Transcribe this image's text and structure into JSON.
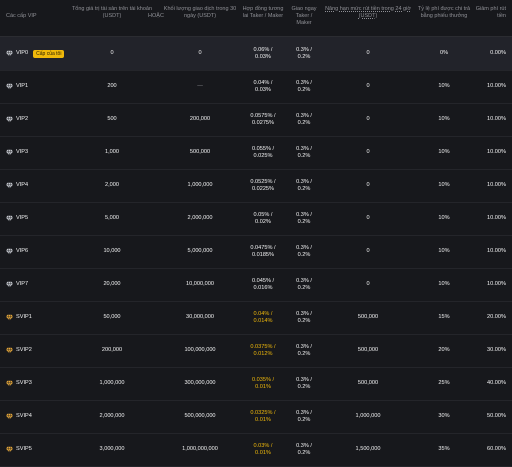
{
  "headers": {
    "level": "Các cấp VIP",
    "assets": "Tổng giá trị tài sản trên tài khoản (USDT)",
    "or": "HOẶC",
    "spot_vol": "Khối lượng giao dịch trong 30 ngày (USDT)",
    "futures": "Hợp đồng tương lai Taker / Maker",
    "spot_fee": "Giao ngay Taker / Maker",
    "withdraw_limit": "Nâng hạn mức rút tiền trong 24 giờ (USDT)",
    "bonus": "Tỷ lệ phí được chi trả bằng phiếu thưởng",
    "withdraw_fee": "Giảm phí rút tiền"
  },
  "current_badge": "Cấp của tôi",
  "rows": [
    {
      "level": "VIP0",
      "assets": "0",
      "volume": "0",
      "futures": "0.06% / 0.03%",
      "spot": "0.3% / 0.2%",
      "limit": "0",
      "bonus": "0%",
      "wfee": "0.00%"
    },
    {
      "level": "VIP1",
      "assets": "200",
      "volume": "—",
      "futures": "0.04% / 0.03%",
      "spot": "0.3% / 0.2%",
      "limit": "0",
      "bonus": "10%",
      "wfee": "10.00%"
    },
    {
      "level": "VIP2",
      "assets": "500",
      "volume": "200,000",
      "futures": "0.0575% / 0.0275%",
      "spot": "0.3% / 0.2%",
      "limit": "0",
      "bonus": "10%",
      "wfee": "10.00%"
    },
    {
      "level": "VIP3",
      "assets": "1,000",
      "volume": "500,000",
      "futures": "0.055% / 0.025%",
      "spot": "0.3% / 0.2%",
      "limit": "0",
      "bonus": "10%",
      "wfee": "10.00%"
    },
    {
      "level": "VIP4",
      "assets": "2,000",
      "volume": "1,000,000",
      "futures": "0.0525% / 0.0225%",
      "spot": "0.3% / 0.2%",
      "limit": "0",
      "bonus": "10%",
      "wfee": "10.00%"
    },
    {
      "level": "VIP5",
      "assets": "5,000",
      "volume": "2,000,000",
      "futures": "0.05% / 0.02%",
      "spot": "0.3% / 0.2%",
      "limit": "0",
      "bonus": "10%",
      "wfee": "10.00%"
    },
    {
      "level": "VIP6",
      "assets": "10,000",
      "volume": "5,000,000",
      "futures": "0.0475% / 0.0185%",
      "spot": "0.3% / 0.2%",
      "limit": "0",
      "bonus": "10%",
      "wfee": "10.00%"
    },
    {
      "level": "VIP7",
      "assets": "20,000",
      "volume": "10,000,000",
      "futures": "0.045% / 0.016%",
      "spot": "0.3% / 0.2%",
      "limit": "0",
      "bonus": "10%",
      "wfee": "10.00%"
    },
    {
      "level": "SVIP1",
      "assets": "50,000",
      "volume": "30,000,000",
      "futures": "0.04% / 0.014%",
      "spot": "0.3% / 0.2%",
      "limit": "500,000",
      "bonus": "15%",
      "wfee": "20.00%"
    },
    {
      "level": "SVIP2",
      "assets": "200,000",
      "volume": "100,000,000",
      "futures": "0.0375% / 0.012%",
      "spot": "0.3% / 0.2%",
      "limit": "500,000",
      "bonus": "20%",
      "wfee": "30.00%"
    },
    {
      "level": "SVIP3",
      "assets": "1,000,000",
      "volume": "300,000,000",
      "futures": "0.035% / 0.01%",
      "spot": "0.3% / 0.2%",
      "limit": "500,000",
      "bonus": "25%",
      "wfee": "40.00%"
    },
    {
      "level": "SVIP4",
      "assets": "2,000,000",
      "volume": "500,000,000",
      "futures": "0.0325% / 0.01%",
      "spot": "0.3% / 0.2%",
      "limit": "1,000,000",
      "bonus": "30%",
      "wfee": "50.00%"
    },
    {
      "level": "SVIP5",
      "assets": "3,000,000",
      "volume": "1,000,000,000",
      "futures": "0.03% / 0.01%",
      "spot": "0.3% / 0.2%",
      "limit": "1,500,000",
      "bonus": "35%",
      "wfee": "60.00%"
    }
  ],
  "colors": {
    "accent": "#f0b90b",
    "gem_silver": "#c9ccd3",
    "gem_gold": "#e8a93b"
  },
  "icons": {
    "gem_silver": "diamond-icon",
    "gem_gold": "diamond-icon"
  }
}
